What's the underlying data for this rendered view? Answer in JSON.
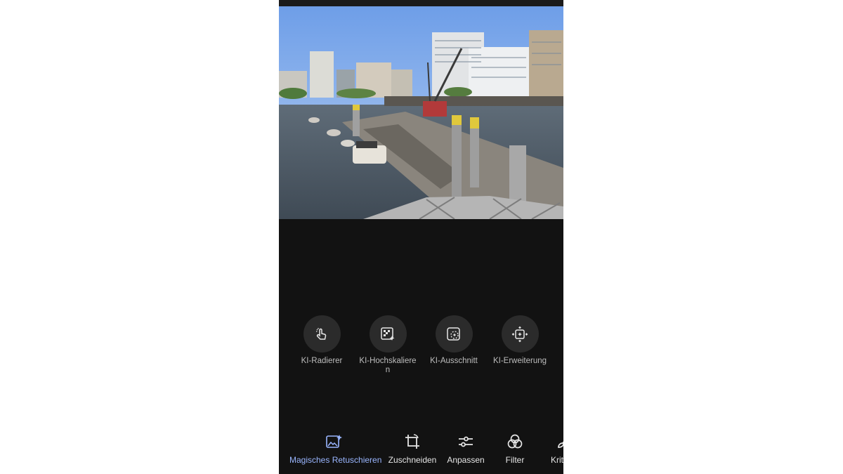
{
  "editor": {
    "photo_alt": "Hamburg harbour photo",
    "tools": [
      {
        "label": "KI-Radierer",
        "icon": "ai-eraser-icon"
      },
      {
        "label": "KI-Hochskalieren",
        "icon": "ai-upscale-icon"
      },
      {
        "label": "KI-Ausschnitt",
        "icon": "ai-cutout-icon"
      },
      {
        "label": "KI-Erweiterung",
        "icon": "ai-expand-icon"
      }
    ],
    "bottom_nav": [
      {
        "label": "Magisches Retuschieren",
        "icon": "magic-retouch-icon",
        "active": true
      },
      {
        "label": "Zuschneiden",
        "icon": "crop-icon"
      },
      {
        "label": "Anpassen",
        "icon": "sliders-icon"
      },
      {
        "label": "Filter",
        "icon": "filter-icon"
      },
      {
        "label": "Krit",
        "icon": "brush-icon"
      }
    ]
  },
  "colors": {
    "background": "#121212",
    "tool_circle": "#2b2b2b",
    "active_accent": "#9ab6ff"
  }
}
